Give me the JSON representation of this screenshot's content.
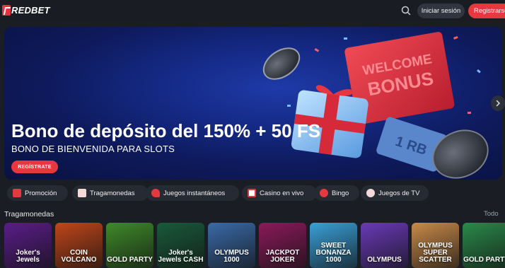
{
  "brand": {
    "name": "REDBET"
  },
  "header": {
    "login_label": "Iniciar sesión",
    "register_label": "Registrarse",
    "search_icon": "search-icon"
  },
  "hero": {
    "title": "Bono de depósito del 150% + 50 FS",
    "subtitle": "BONO DE BIENVENIDA PARA SLOTS",
    "cta_label": "REGÍSTRATE",
    "art_text_1": "WELCOME",
    "art_text_2": "BONUS",
    "art_ticket": "1 RB"
  },
  "categories": [
    {
      "label": "Promoción",
      "icon": "gift-icon"
    },
    {
      "label": "Tragamonedas",
      "icon": "slots-icon"
    },
    {
      "label": "Juegos instantáneos",
      "icon": "rocket-icon"
    },
    {
      "label": "Casino en vivo",
      "icon": "cards-icon"
    },
    {
      "label": "Bingo",
      "icon": "bingo-ball-icon"
    },
    {
      "label": "Juegos de TV",
      "icon": "tv-wheel-icon"
    }
  ],
  "section": {
    "title": "Tragamonedas",
    "all_label": "Todo"
  },
  "games": [
    {
      "title": "Joker's Jewels",
      "bg": "#5a1d8a"
    },
    {
      "title": "COIN VOLCANO",
      "bg": "#c0461a"
    },
    {
      "title": "GOLD PARTY",
      "bg": "#3f8a2a"
    },
    {
      "title": "Joker's Jewels CASH",
      "bg": "#1a5a3a"
    },
    {
      "title": "OLYMPUS 1000",
      "bg": "#3a6aa8"
    },
    {
      "title": "JACKPOT JOKER",
      "bg": "#8a1a5a"
    },
    {
      "title": "SWEET BONANZA 1000",
      "bg": "#3aa0d8"
    },
    {
      "title": "OLYMPUS",
      "bg": "#6a3ab8"
    },
    {
      "title": "OLYMPUS SUPER SCATTER",
      "bg": "#c88a4a"
    },
    {
      "title": "GOLD PARTY",
      "bg": "#2a8a4a"
    }
  ],
  "colors": {
    "accent": "#e6383f",
    "background": "#1a1d24",
    "chip": "#262a33"
  }
}
